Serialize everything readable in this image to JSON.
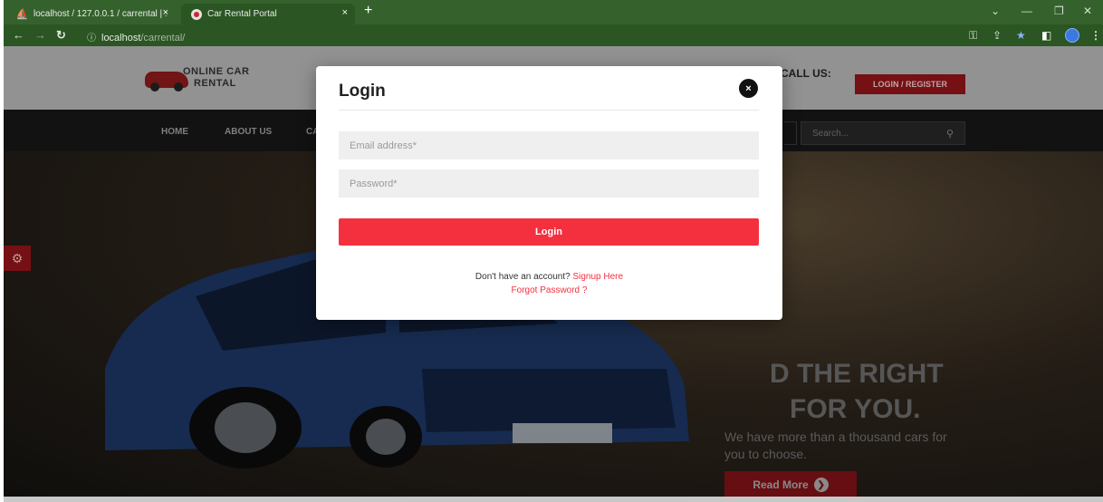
{
  "browser": {
    "tabs": [
      {
        "title": "localhost / 127.0.0.1 / carrental | :",
        "active": false,
        "icon": "phpmyadmin-icon"
      },
      {
        "title": "Car Rental Portal",
        "active": true,
        "icon": "car-favicon"
      }
    ],
    "new_tab": "+",
    "close_glyph": "×",
    "url_host": "localhost",
    "url_path": "/carrental/"
  },
  "site": {
    "logo_line1": "ONLINE CAR",
    "logo_line2": "RENTAL",
    "call_us": "CALL US:",
    "login_register": "LOGIN / REGISTER",
    "nav": [
      "HOME",
      "ABOUT US",
      "CA"
    ],
    "search_placeholder": "Search...",
    "hero_line1": "D THE RIGHT",
    "hero_line2": "FOR YOU.",
    "hero_text": "We have more than a thousand cars for you to choose.",
    "read_more": "Read More"
  },
  "modal": {
    "title": "Login",
    "close": "×",
    "email_placeholder": "Email address*",
    "password_placeholder": "Password*",
    "login_button": "Login",
    "signup_prompt": "Don't have an account?",
    "signup_link": "Signup Here",
    "forgot_link": "Forgot Password ?"
  },
  "colors": {
    "accent_red": "#f4303f",
    "dark_red": "#8f1419",
    "chrome_green": "#35622c"
  }
}
